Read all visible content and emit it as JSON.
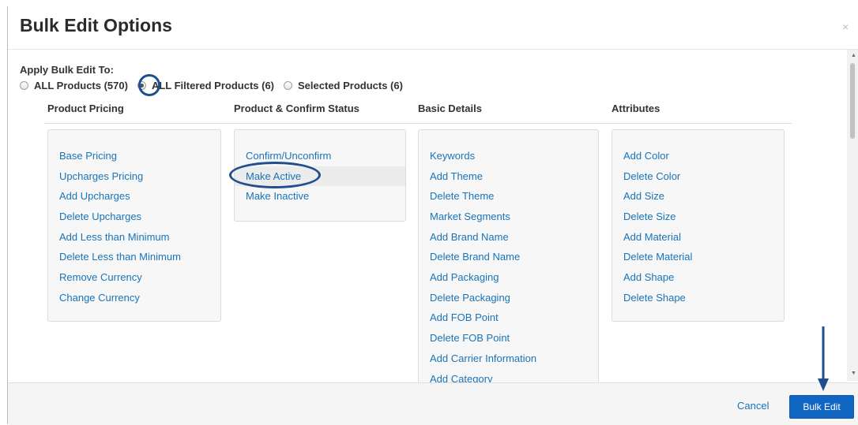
{
  "modal": {
    "title": "Bulk Edit Options",
    "close_label": "×"
  },
  "apply": {
    "label": "Apply Bulk Edit To:",
    "options": [
      {
        "label": "ALL Products (570)",
        "checked": false
      },
      {
        "label": "ALL Filtered Products (6)",
        "checked": true
      },
      {
        "label": "Selected Products (6)",
        "checked": false
      }
    ]
  },
  "columns": [
    {
      "heading": "Product Pricing",
      "items": [
        "Base Pricing",
        "Upcharges Pricing",
        "Add Upcharges",
        "Delete Upcharges",
        "Add Less than Minimum",
        "Delete Less than Minimum",
        "Remove Currency",
        "Change Currency"
      ]
    },
    {
      "heading": "Product & Confirm Status",
      "items": [
        "Confirm/Unconfirm",
        "Make Active",
        "Make Inactive"
      ],
      "hovered_item": "Make Active"
    },
    {
      "heading": "Basic Details",
      "items": [
        "Keywords",
        "Add Theme",
        "Delete Theme",
        "Market Segments",
        "Add Brand Name",
        "Delete Brand Name",
        "Add Packaging",
        "Delete Packaging",
        "Add FOB Point",
        "Delete FOB Point",
        "Add Carrier Information",
        "Add Category"
      ]
    },
    {
      "heading": "Attributes",
      "items": [
        "Add Color",
        "Delete Color",
        "Add Size",
        "Delete Size",
        "Add Material",
        "Delete Material",
        "Add Shape",
        "Delete Shape"
      ]
    }
  ],
  "footer": {
    "cancel_label": "Cancel",
    "submit_label": "Bulk Edit"
  },
  "colors": {
    "link": "#1a74b8",
    "primary_button": "#1166c4",
    "annotation": "#1f4f8f"
  }
}
